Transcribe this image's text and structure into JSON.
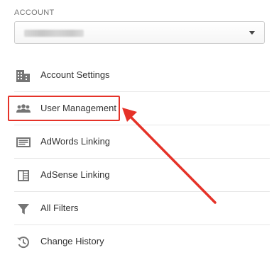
{
  "account": {
    "section_label": "ACCOUNT",
    "selected_value_hidden": true
  },
  "menu": {
    "items": [
      {
        "label": "Account Settings",
        "icon": "building-icon"
      },
      {
        "label": "User Management",
        "icon": "users-icon",
        "highlighted": true
      },
      {
        "label": "AdWords Linking",
        "icon": "adwords-link-icon"
      },
      {
        "label": "AdSense Linking",
        "icon": "adsense-link-icon"
      },
      {
        "label": "All Filters",
        "icon": "filter-icon"
      },
      {
        "label": "Change History",
        "icon": "history-icon"
      }
    ]
  },
  "annotation": {
    "highlight_color": "#e53228"
  },
  "colors": {
    "text": "#333333",
    "icon": "#757575",
    "separator": "#e6e6e6",
    "annotation_red": "#e53228"
  }
}
